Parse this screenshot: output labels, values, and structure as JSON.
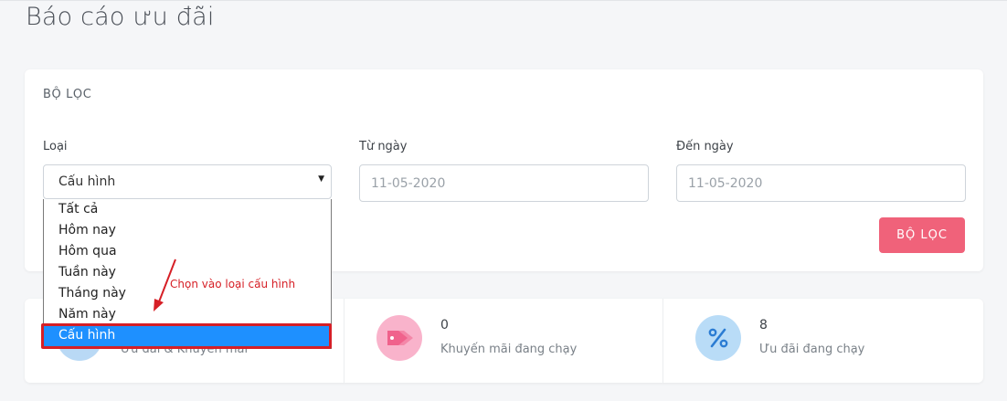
{
  "page": {
    "title": "Báo cáo ưu đãi"
  },
  "filter": {
    "title": "BỘ LỌC",
    "type_label": "Loại",
    "type_value": "Cấu hình",
    "from_label": "Từ ngày",
    "from_placeholder": "11-05-2020",
    "to_label": "Đến ngày",
    "to_placeholder": "11-05-2020",
    "button_label": "BỘ LỌC"
  },
  "dropdown": {
    "options": [
      "Tất cả",
      "Hôm nay",
      "Hôm qua",
      "Tuần này",
      "Tháng này",
      "Năm này",
      "Cấu hình"
    ],
    "selected": "Cấu hình"
  },
  "annotation": {
    "text": "Chọn vào loại cấu hình"
  },
  "stats": [
    {
      "value": "",
      "label": "Ưu đãi & Khuyến mãi",
      "icon": "offers-icon",
      "color": "#b9d9f5"
    },
    {
      "value": "0",
      "label": "Khuyến mãi đang chạy",
      "icon": "tag-icon",
      "color": "#f9b3cb"
    },
    {
      "value": "8",
      "label": "Ưu đãi đang chạy",
      "icon": "percent-icon",
      "color": "#b9dcf7"
    }
  ],
  "colors": {
    "accent": "#f0627a",
    "selection": "#1e90ff",
    "annotation": "#d61f26"
  }
}
